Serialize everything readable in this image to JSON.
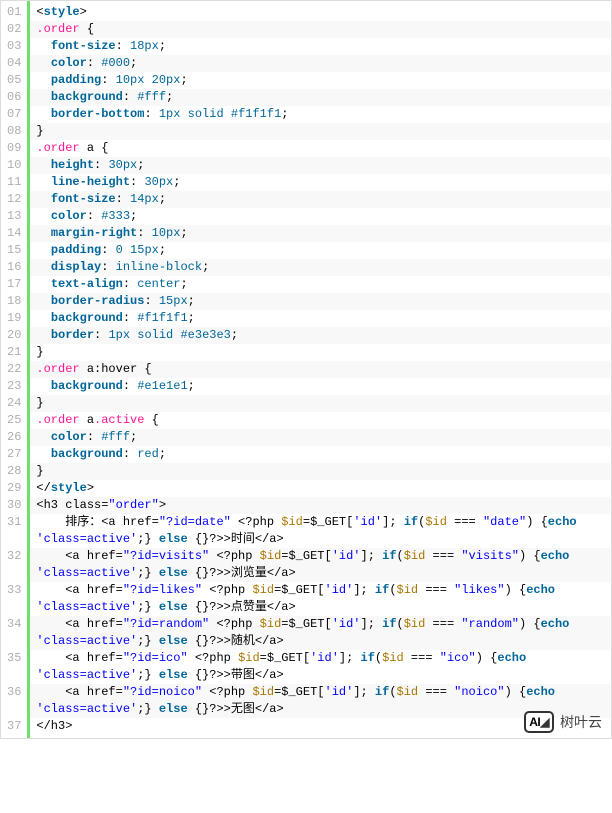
{
  "lines": [
    {
      "n": "01",
      "bg": "odd",
      "ind": 0,
      "tokens": [
        [
          "plain",
          "<"
        ],
        [
          "kw",
          "style"
        ],
        [
          "plain",
          ">"
        ]
      ]
    },
    {
      "n": "02",
      "bg": "even",
      "ind": 0,
      "tokens": [
        [
          "id",
          ".order"
        ],
        [
          "plain",
          " {"
        ]
      ]
    },
    {
      "n": "03",
      "bg": "odd",
      "ind": 1,
      "tokens": [
        [
          "kw",
          "font-size"
        ],
        [
          "plain",
          ": "
        ],
        [
          "val",
          "18px"
        ],
        [
          "plain",
          ";"
        ]
      ]
    },
    {
      "n": "04",
      "bg": "even",
      "ind": 1,
      "tokens": [
        [
          "kw",
          "color"
        ],
        [
          "plain",
          ": "
        ],
        [
          "color",
          "#000"
        ],
        [
          "plain",
          ";"
        ]
      ]
    },
    {
      "n": "05",
      "bg": "odd",
      "ind": 1,
      "tokens": [
        [
          "kw",
          "padding"
        ],
        [
          "plain",
          ": "
        ],
        [
          "val",
          "10px"
        ],
        [
          "plain",
          " "
        ],
        [
          "val",
          "20px"
        ],
        [
          "plain",
          ";"
        ]
      ]
    },
    {
      "n": "06",
      "bg": "even",
      "ind": 1,
      "tokens": [
        [
          "kw",
          "background"
        ],
        [
          "plain",
          ": "
        ],
        [
          "color",
          "#fff"
        ],
        [
          "plain",
          ";"
        ]
      ]
    },
    {
      "n": "07",
      "bg": "odd",
      "ind": 1,
      "tokens": [
        [
          "kw",
          "border-bottom"
        ],
        [
          "plain",
          ": "
        ],
        [
          "val",
          "1px"
        ],
        [
          "plain",
          " "
        ],
        [
          "val",
          "solid"
        ],
        [
          "plain",
          " "
        ],
        [
          "color",
          "#f1f1f1"
        ],
        [
          "plain",
          ";"
        ]
      ]
    },
    {
      "n": "08",
      "bg": "even",
      "ind": 0,
      "tokens": [
        [
          "plain",
          "}"
        ]
      ]
    },
    {
      "n": "09",
      "bg": "odd",
      "ind": 0,
      "tokens": [
        [
          "id",
          ".order"
        ],
        [
          "plain",
          " a {"
        ]
      ]
    },
    {
      "n": "10",
      "bg": "even",
      "ind": 1,
      "tokens": [
        [
          "kw",
          "height"
        ],
        [
          "plain",
          ": "
        ],
        [
          "val",
          "30px"
        ],
        [
          "plain",
          ";"
        ]
      ]
    },
    {
      "n": "11",
      "bg": "odd",
      "ind": 1,
      "tokens": [
        [
          "kw",
          "line-height"
        ],
        [
          "plain",
          ": "
        ],
        [
          "val",
          "30px"
        ],
        [
          "plain",
          ";"
        ]
      ]
    },
    {
      "n": "12",
      "bg": "even",
      "ind": 1,
      "tokens": [
        [
          "kw",
          "font-size"
        ],
        [
          "plain",
          ": "
        ],
        [
          "val",
          "14px"
        ],
        [
          "plain",
          ";"
        ]
      ]
    },
    {
      "n": "13",
      "bg": "odd",
      "ind": 1,
      "tokens": [
        [
          "kw",
          "color"
        ],
        [
          "plain",
          ": "
        ],
        [
          "color",
          "#333"
        ],
        [
          "plain",
          ";"
        ]
      ]
    },
    {
      "n": "14",
      "bg": "even",
      "ind": 1,
      "tokens": [
        [
          "kw",
          "margin-right"
        ],
        [
          "plain",
          ": "
        ],
        [
          "val",
          "10px"
        ],
        [
          "plain",
          ";"
        ]
      ]
    },
    {
      "n": "15",
      "bg": "odd",
      "ind": 1,
      "tokens": [
        [
          "kw",
          "padding"
        ],
        [
          "plain",
          ": "
        ],
        [
          "val",
          "0"
        ],
        [
          "plain",
          " "
        ],
        [
          "val",
          "15px"
        ],
        [
          "plain",
          ";"
        ]
      ]
    },
    {
      "n": "16",
      "bg": "even",
      "ind": 1,
      "tokens": [
        [
          "kw",
          "display"
        ],
        [
          "plain",
          ": "
        ],
        [
          "val",
          "inline-block"
        ],
        [
          "plain",
          ";"
        ]
      ]
    },
    {
      "n": "17",
      "bg": "odd",
      "ind": 1,
      "tokens": [
        [
          "kw",
          "text-align"
        ],
        [
          "plain",
          ": "
        ],
        [
          "val",
          "center"
        ],
        [
          "plain",
          ";"
        ]
      ]
    },
    {
      "n": "18",
      "bg": "even",
      "ind": 1,
      "tokens": [
        [
          "kw",
          "border-radius"
        ],
        [
          "plain",
          ": "
        ],
        [
          "val",
          "15px"
        ],
        [
          "plain",
          ";"
        ]
      ]
    },
    {
      "n": "19",
      "bg": "odd",
      "ind": 1,
      "tokens": [
        [
          "kw",
          "background"
        ],
        [
          "plain",
          ": "
        ],
        [
          "color",
          "#f1f1f1"
        ],
        [
          "plain",
          ";"
        ]
      ]
    },
    {
      "n": "20",
      "bg": "even",
      "ind": 1,
      "tokens": [
        [
          "kw",
          "border"
        ],
        [
          "plain",
          ": "
        ],
        [
          "val",
          "1px"
        ],
        [
          "plain",
          " "
        ],
        [
          "val",
          "solid"
        ],
        [
          "plain",
          " "
        ],
        [
          "color",
          "#e3e3e3"
        ],
        [
          "plain",
          ";"
        ]
      ]
    },
    {
      "n": "21",
      "bg": "odd",
      "ind": 0,
      "tokens": [
        [
          "plain",
          "}"
        ]
      ]
    },
    {
      "n": "22",
      "bg": "even",
      "ind": 0,
      "tokens": [
        [
          "id",
          ".order"
        ],
        [
          "plain",
          " a:hover {"
        ]
      ]
    },
    {
      "n": "23",
      "bg": "odd",
      "ind": 1,
      "tokens": [
        [
          "kw",
          "background"
        ],
        [
          "plain",
          ": "
        ],
        [
          "color",
          "#e1e1e1"
        ],
        [
          "plain",
          ";"
        ]
      ]
    },
    {
      "n": "24",
      "bg": "even",
      "ind": 0,
      "tokens": [
        [
          "plain",
          "}"
        ]
      ]
    },
    {
      "n": "25",
      "bg": "odd",
      "ind": 0,
      "tokens": [
        [
          "id",
          ".order"
        ],
        [
          "plain",
          " a"
        ],
        [
          "id",
          ".active"
        ],
        [
          "plain",
          " {"
        ]
      ]
    },
    {
      "n": "26",
      "bg": "even",
      "ind": 1,
      "tokens": [
        [
          "kw",
          "color"
        ],
        [
          "plain",
          ": "
        ],
        [
          "color",
          "#fff"
        ],
        [
          "plain",
          ";"
        ]
      ]
    },
    {
      "n": "27",
      "bg": "odd",
      "ind": 1,
      "tokens": [
        [
          "kw",
          "background"
        ],
        [
          "plain",
          ": "
        ],
        [
          "val",
          "red"
        ],
        [
          "plain",
          ";"
        ]
      ]
    },
    {
      "n": "28",
      "bg": "even",
      "ind": 0,
      "tokens": [
        [
          "plain",
          "}"
        ]
      ]
    },
    {
      "n": "29",
      "bg": "odd",
      "ind": 0,
      "tokens": [
        [
          "plain",
          "</"
        ],
        [
          "kw",
          "style"
        ],
        [
          "plain",
          ">"
        ]
      ]
    },
    {
      "n": "30",
      "bg": "even",
      "ind": 0,
      "tokens": [
        [
          "plain",
          "<h3 class="
        ],
        [
          "str",
          "\"order\""
        ],
        [
          "plain",
          ">"
        ]
      ]
    },
    {
      "n": "31",
      "bg": "odd",
      "ind": 0,
      "segments": [
        {
          "tokens": [
            [
              "plain",
              "    排序：<a href="
            ],
            [
              "str",
              "\"?id=date\""
            ],
            [
              "plain",
              " <?php "
            ],
            [
              "var",
              "$id"
            ],
            [
              "plain",
              "=$_GET["
            ],
            [
              "str",
              "'id'"
            ],
            [
              "plain",
              "]; "
            ],
            [
              "kw",
              "if"
            ],
            [
              "plain",
              "("
            ],
            [
              "var",
              "$id"
            ],
            [
              "plain",
              " === "
            ],
            [
              "str",
              "\"date\""
            ],
            [
              "plain",
              ") {"
            ],
            [
              "kw",
              "echo"
            ]
          ]
        },
        {
          "tokens": [
            [
              "str",
              "'class=active'"
            ],
            [
              "plain",
              ";} "
            ],
            [
              "kw",
              "else"
            ],
            [
              "plain",
              " {}?>>时间</a>"
            ]
          ]
        }
      ]
    },
    {
      "n": "32",
      "bg": "even",
      "ind": 0,
      "segments": [
        {
          "tokens": [
            [
              "plain",
              "    <a href="
            ],
            [
              "str",
              "\"?id=visits\""
            ],
            [
              "plain",
              " <?php "
            ],
            [
              "var",
              "$id"
            ],
            [
              "plain",
              "=$_GET["
            ],
            [
              "str",
              "'id'"
            ],
            [
              "plain",
              "]; "
            ],
            [
              "kw",
              "if"
            ],
            [
              "plain",
              "("
            ],
            [
              "var",
              "$id"
            ],
            [
              "plain",
              " === "
            ],
            [
              "str",
              "\"visits\""
            ],
            [
              "plain",
              ") {"
            ],
            [
              "kw",
              "echo"
            ]
          ]
        },
        {
          "tokens": [
            [
              "str",
              "'class=active'"
            ],
            [
              "plain",
              ";} "
            ],
            [
              "kw",
              "else"
            ],
            [
              "plain",
              " {}?>>浏览量</a>"
            ]
          ]
        }
      ]
    },
    {
      "n": "33",
      "bg": "odd",
      "ind": 0,
      "segments": [
        {
          "tokens": [
            [
              "plain",
              "    <a href="
            ],
            [
              "str",
              "\"?id=likes\""
            ],
            [
              "plain",
              " <?php "
            ],
            [
              "var",
              "$id"
            ],
            [
              "plain",
              "=$_GET["
            ],
            [
              "str",
              "'id'"
            ],
            [
              "plain",
              "]; "
            ],
            [
              "kw",
              "if"
            ],
            [
              "plain",
              "("
            ],
            [
              "var",
              "$id"
            ],
            [
              "plain",
              " === "
            ],
            [
              "str",
              "\"likes\""
            ],
            [
              "plain",
              ") {"
            ],
            [
              "kw",
              "echo"
            ]
          ]
        },
        {
          "tokens": [
            [
              "str",
              "'class=active'"
            ],
            [
              "plain",
              ";} "
            ],
            [
              "kw",
              "else"
            ],
            [
              "plain",
              " {}?>>点赞量</a>"
            ]
          ]
        }
      ]
    },
    {
      "n": "34",
      "bg": "even",
      "ind": 0,
      "segments": [
        {
          "tokens": [
            [
              "plain",
              "    <a href="
            ],
            [
              "str",
              "\"?id=random\""
            ],
            [
              "plain",
              " <?php "
            ],
            [
              "var",
              "$id"
            ],
            [
              "plain",
              "=$_GET["
            ],
            [
              "str",
              "'id'"
            ],
            [
              "plain",
              "]; "
            ],
            [
              "kw",
              "if"
            ],
            [
              "plain",
              "("
            ],
            [
              "var",
              "$id"
            ],
            [
              "plain",
              " === "
            ],
            [
              "str",
              "\"random\""
            ],
            [
              "plain",
              ") {"
            ],
            [
              "kw",
              "echo"
            ]
          ]
        },
        {
          "tokens": [
            [
              "str",
              "'class=active'"
            ],
            [
              "plain",
              ";} "
            ],
            [
              "kw",
              "else"
            ],
            [
              "plain",
              " {}?>>随机</a>"
            ]
          ]
        }
      ]
    },
    {
      "n": "35",
      "bg": "odd",
      "ind": 0,
      "segments": [
        {
          "tokens": [
            [
              "plain",
              "    <a href="
            ],
            [
              "str",
              "\"?id=ico\""
            ],
            [
              "plain",
              " <?php "
            ],
            [
              "var",
              "$id"
            ],
            [
              "plain",
              "=$_GET["
            ],
            [
              "str",
              "'id'"
            ],
            [
              "plain",
              "]; "
            ],
            [
              "kw",
              "if"
            ],
            [
              "plain",
              "("
            ],
            [
              "var",
              "$id"
            ],
            [
              "plain",
              " === "
            ],
            [
              "str",
              "\"ico\""
            ],
            [
              "plain",
              ") {"
            ],
            [
              "kw",
              "echo"
            ]
          ]
        },
        {
          "tokens": [
            [
              "str",
              "'class=active'"
            ],
            [
              "plain",
              ";} "
            ],
            [
              "kw",
              "else"
            ],
            [
              "plain",
              " {}?>>带图</a>"
            ]
          ]
        }
      ]
    },
    {
      "n": "36",
      "bg": "even",
      "ind": 0,
      "segments": [
        {
          "tokens": [
            [
              "plain",
              "    <a href="
            ],
            [
              "str",
              "\"?id=noico\""
            ],
            [
              "plain",
              " <?php "
            ],
            [
              "var",
              "$id"
            ],
            [
              "plain",
              "=$_GET["
            ],
            [
              "str",
              "'id'"
            ],
            [
              "plain",
              "]; "
            ],
            [
              "kw",
              "if"
            ],
            [
              "plain",
              "("
            ],
            [
              "var",
              "$id"
            ],
            [
              "plain",
              " === "
            ],
            [
              "str",
              "\"noico\""
            ],
            [
              "plain",
              ") {"
            ],
            [
              "kw",
              "echo"
            ]
          ]
        },
        {
          "tokens": [
            [
              "str",
              "'class=active'"
            ],
            [
              "plain",
              ";} "
            ],
            [
              "kw",
              "else"
            ],
            [
              "plain",
              " {}?>>无图</a>"
            ]
          ]
        }
      ]
    },
    {
      "n": "37",
      "bg": "odd",
      "ind": 0,
      "tokens": [
        [
          "plain",
          "</h3>"
        ]
      ]
    }
  ],
  "logo": {
    "badge": "AI",
    "text": "树叶云"
  }
}
